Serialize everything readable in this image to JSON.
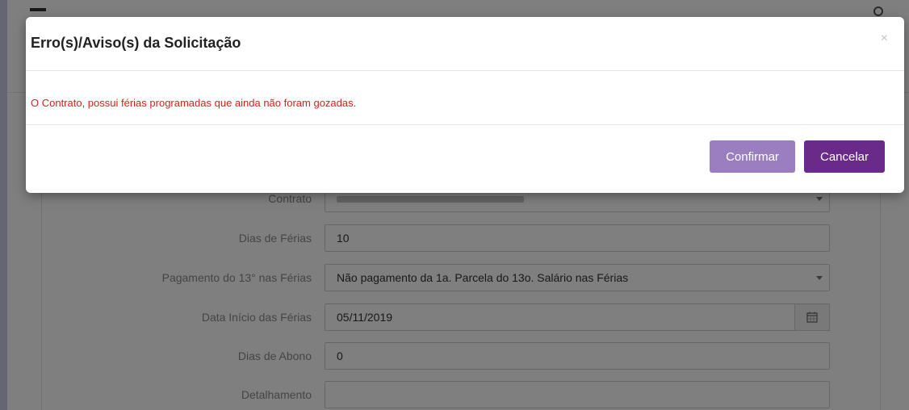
{
  "form": {
    "contrato_label": "Contrato",
    "dias_ferias_label": "Dias de Férias",
    "dias_ferias_value": "10",
    "pagamento_13_label": "Pagamento do 13° nas Férias",
    "pagamento_13_value": "Não pagamento da 1a. Parcela do 13o. Salário nas Férias",
    "data_inicio_label": "Data Início das Férias",
    "data_inicio_value": "05/11/2019",
    "dias_abono_label": "Dias de Abono",
    "dias_abono_value": "0",
    "detalhamento_label": "Detalhamento",
    "detalhamento_value": ""
  },
  "modal": {
    "title": "Erro(s)/Aviso(s) da Solicitação",
    "close_symbol": "×",
    "message": "O Contrato, possui férias programadas que ainda não foram gozadas.",
    "confirm_label": "Confirmar",
    "cancel_label": "Cancelar",
    "message_color": "#e01b1b",
    "confirm_color": "#9a7ec0",
    "cancel_color": "#6a2a8a"
  },
  "icons": {
    "calendar": "calendar-icon",
    "menu": "hamburger-menu-icon",
    "user": "user-icon"
  }
}
